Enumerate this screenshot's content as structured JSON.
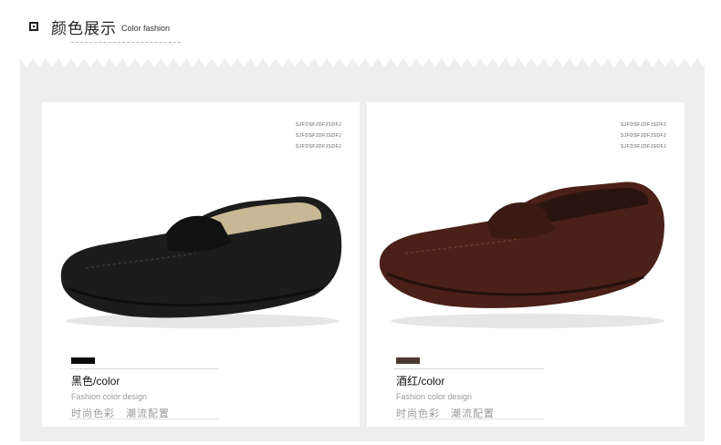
{
  "header": {
    "title_cn": "颜色展示",
    "title_en": "Color fashion"
  },
  "cards": [
    {
      "code_lines": [
        "SJFDSFJDFJSDFJ",
        "SJFDSFJDFJSDFJ",
        "SJFDSFJDFJSDFJ"
      ],
      "swatch_color": "#0a0a0a",
      "color_name": "黑色/color",
      "design_label": "Fashion color design",
      "fashion_cn_1": "时尚色彩",
      "fashion_cn_2": "潮流配置",
      "shoe_color": "#1c1c1c"
    },
    {
      "code_lines": [
        "SJFDSFJDFJSDFJ",
        "SJFDSFJDFJSDFJ",
        "SJFDSFJDFJSDFJ"
      ],
      "swatch_color": "#4a3a34",
      "color_name": "酒红/color",
      "design_label": "Fashion color design",
      "fashion_cn_1": "时尚色彩",
      "fashion_cn_2": "潮流配置",
      "shoe_color": "#4a2018"
    }
  ],
  "colors": {
    "panel": "#eeeeee",
    "card": "#ffffff"
  }
}
